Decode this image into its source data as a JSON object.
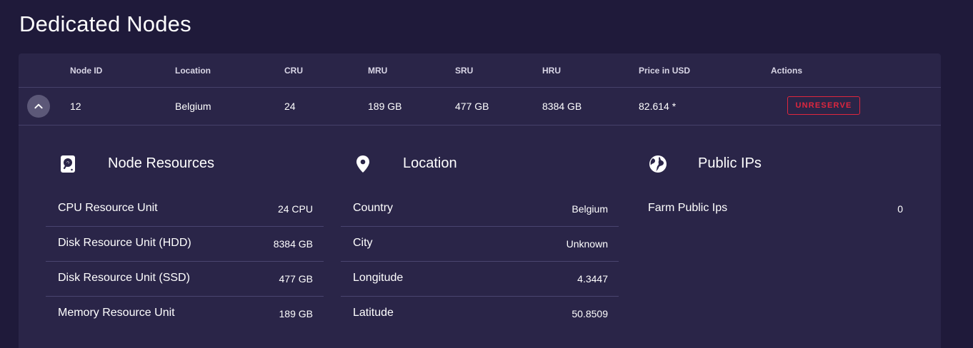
{
  "page": {
    "title": "Dedicated Nodes"
  },
  "table": {
    "headers": {
      "node_id": "Node ID",
      "location": "Location",
      "cru": "CRU",
      "mru": "MRU",
      "sru": "SRU",
      "hru": "HRU",
      "price": "Price in USD",
      "actions": "Actions"
    },
    "row": {
      "node_id": "12",
      "location": "Belgium",
      "cru": "24",
      "mru": "189 GB",
      "sru": "477 GB",
      "hru": "8384 GB",
      "price": "82.614 *",
      "action_label": "UNRESERVE"
    }
  },
  "details": {
    "resources": {
      "title": "Node Resources",
      "icon": "harddisk-icon",
      "items": [
        {
          "label": "CPU Resource Unit",
          "value": "24 CPU"
        },
        {
          "label": "Disk Resource Unit (HDD)",
          "value": "8384 GB"
        },
        {
          "label": "Disk Resource Unit (SSD)",
          "value": "477 GB"
        },
        {
          "label": "Memory Resource Unit",
          "value": "189 GB"
        }
      ]
    },
    "location": {
      "title": "Location",
      "icon": "map-marker-icon",
      "items": [
        {
          "label": "Country",
          "value": "Belgium"
        },
        {
          "label": "City",
          "value": "Unknown"
        },
        {
          "label": "Longitude",
          "value": "4.3447"
        },
        {
          "label": "Latitude",
          "value": "50.8509"
        }
      ]
    },
    "public_ips": {
      "title": "Public IPs",
      "icon": "globe-icon",
      "items": [
        {
          "label": "Farm Public Ips",
          "value": "0"
        }
      ]
    }
  },
  "colors": {
    "background": "#1f1a3a",
    "card": "#2a2548",
    "accent_red": "#e0263e"
  }
}
